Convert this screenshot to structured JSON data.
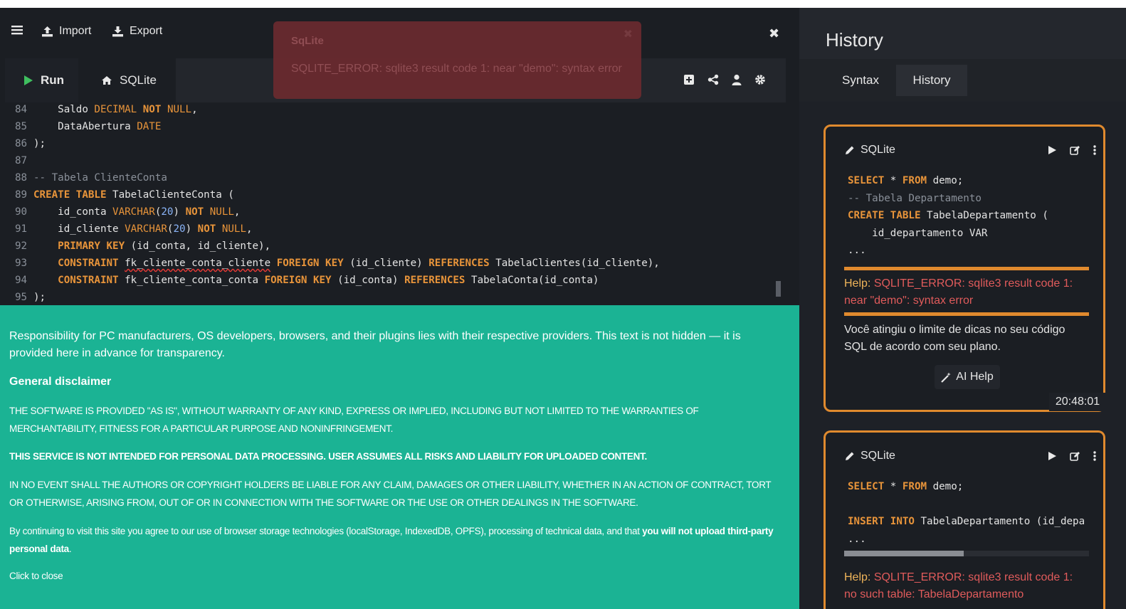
{
  "toolbar": {
    "menu_icon": "hamburger-icon",
    "import_label": "Import",
    "export_label": "Export",
    "close_icon": "close-icon"
  },
  "tabs": {
    "run_label": "Run",
    "sqlite_label": "SQLite",
    "icons": [
      "add-icon",
      "share-icon",
      "user-icon",
      "gear-icon"
    ]
  },
  "editor": {
    "lines": [
      {
        "n": "84",
        "text": "    Saldo DECIMAL NOT NULL,"
      },
      {
        "n": "85",
        "text": "    DataAbertura DATE"
      },
      {
        "n": "86",
        "text": ");"
      },
      {
        "n": "87",
        "text": ""
      },
      {
        "n": "88",
        "text": "-- Tabela ClienteConta"
      },
      {
        "n": "89",
        "text": "CREATE TABLE TabelaClienteConta ("
      },
      {
        "n": "90",
        "text": "    id_conta VARCHAR(20) NOT NULL,"
      },
      {
        "n": "91",
        "text": "    id_cliente VARCHAR(20) NOT NULL,"
      },
      {
        "n": "92",
        "text": "    PRIMARY KEY (id_conta, id_cliente),"
      },
      {
        "n": "93",
        "text": "    CONSTRAINT fk_cliente_conta_cliente FOREIGN KEY (id_cliente) REFERENCES TabelaClientes(id_cliente),"
      },
      {
        "n": "94",
        "text": "    CONSTRAINT fk_cliente_conta_conta FOREIGN KEY (id_conta) REFERENCES TabelaConta(id_conta)"
      },
      {
        "n": "95",
        "text": ");"
      }
    ]
  },
  "toast": {
    "title": "SqLite",
    "message": "SQLITE_ERROR: sqlite3 result code 1: near \"demo\": syntax error"
  },
  "disclaimer": {
    "intro": "Responsibility for PC manufacturers, OS developers, browsers, and their plugins lies with their respective providers. This text is not hidden — it is provided here in advance for transparency.",
    "heading": "General disclaimer",
    "warranty": "THE SOFTWARE IS PROVIDED \"AS IS\", WITHOUT WARRANTY OF ANY KIND, EXPRESS OR IMPLIED, INCLUDING BUT NOT LIMITED TO THE WARRANTIES OF MERCHANTABILITY, FITNESS FOR A PARTICULAR PURPOSE AND NONINFRINGEMENT.",
    "service": "THIS SERVICE IS NOT INTENDED FOR PERSONAL DATA PROCESSING. USER ASSUMES ALL RISKS AND LIABILITY FOR UPLOADED CONTENT.",
    "liability": "IN NO EVENT SHALL THE AUTHORS OR COPYRIGHT HOLDERS BE LIABLE FOR ANY CLAIM, DAMAGES OR OTHER LIABILITY, WHETHER IN AN ACTION OF CONTRACT, TORT OR OTHERWISE, ARISING FROM, OUT OF OR IN CONNECTION WITH THE SOFTWARE OR THE USE OR OTHER DEALINGS IN THE SOFTWARE.",
    "consent_prefix": "By continuing to visit this site you agree to our use of browser storage technologies (localStorage, IndexedDB, OPFS), processing of technical data, and that ",
    "consent_bold": "you will not upload third-party personal data",
    "consent_suffix": ".",
    "close_label": "Click to close"
  },
  "history": {
    "title": "History",
    "tab_syntax": "Syntax",
    "tab_history": "History",
    "cards": [
      {
        "engine": "SQLite",
        "code": [
          "SELECT * FROM demo;",
          "-- Tabela Departamento",
          "CREATE TABLE TabelaDepartamento (",
          "    id_departamento VAR",
          "..."
        ],
        "help_label": "Help:",
        "help_error": "SQLITE_ERROR: sqlite3 result code 1: near \"demo\": syntax error",
        "limit_msg": "Você atingiu o limite de dicas no seu código SQL de acordo com seu plano.",
        "ai_help": "AI Help",
        "time": "20:48:01"
      },
      {
        "engine": "SQLite",
        "code": [
          "SELECT * FROM demo;",
          "",
          "INSERT INTO TabelaDepartamento (id_depa",
          "..."
        ],
        "help_label": "Help:",
        "help_error": "SQLITE_ERROR: sqlite3 result code 1: no such table: TabelaDepartamento"
      }
    ]
  }
}
